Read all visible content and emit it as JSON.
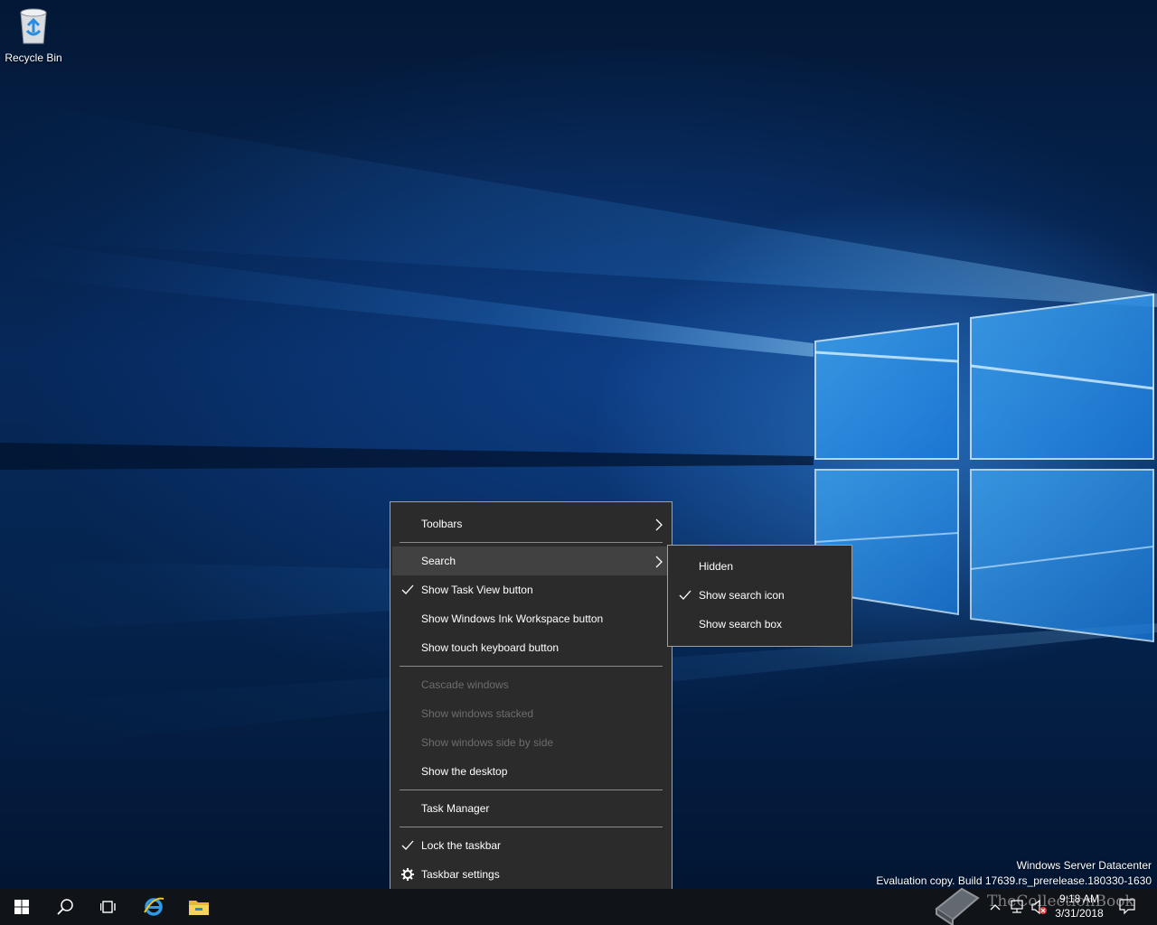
{
  "desktop": {
    "icons": [
      {
        "label": "Recycle Bin",
        "icon": "recycle-bin-icon"
      }
    ]
  },
  "watermark": {
    "line1": "Windows Server Datacenter",
    "line2": "Evaluation copy. Build 17639.rs_prerelease.180330-1630"
  },
  "context_menu": {
    "items": [
      {
        "label": "Toolbars",
        "submenu": true
      },
      {
        "label": "Search",
        "submenu": true,
        "highlighted": true
      },
      {
        "label": "Show Task View button",
        "checked": true
      },
      {
        "label": "Show Windows Ink Workspace button"
      },
      {
        "label": "Show touch keyboard button"
      },
      {
        "label": "Cascade windows",
        "disabled": true
      },
      {
        "label": "Show windows stacked",
        "disabled": true
      },
      {
        "label": "Show windows side by side",
        "disabled": true
      },
      {
        "label": "Show the desktop"
      },
      {
        "label": "Task Manager"
      },
      {
        "label": "Lock the taskbar",
        "checked": true
      },
      {
        "label": "Taskbar settings",
        "icon": "gear-icon"
      }
    ]
  },
  "search_submenu": {
    "items": [
      {
        "label": "Hidden"
      },
      {
        "label": "Show search icon",
        "checked": true
      },
      {
        "label": "Show search box"
      }
    ]
  },
  "taskbar": {
    "buttons": [
      "start-icon",
      "search-icon",
      "task-view-icon",
      "internet-explorer-icon",
      "file-explorer-icon"
    ],
    "clock": {
      "time": "9:18 AM",
      "date": "3/31/2018"
    },
    "tray_icons": [
      "chevron-up-icon",
      "network-icon",
      "volume-muted-icon",
      "notification-icon"
    ]
  },
  "overlay": {
    "brand_text": "TheCollectionBook"
  },
  "colors": {
    "menu_bg": "#2b2b2b",
    "menu_highlight": "#414141",
    "taskbar_bg": "#101318",
    "disabled_text": "#6d6d6d"
  }
}
